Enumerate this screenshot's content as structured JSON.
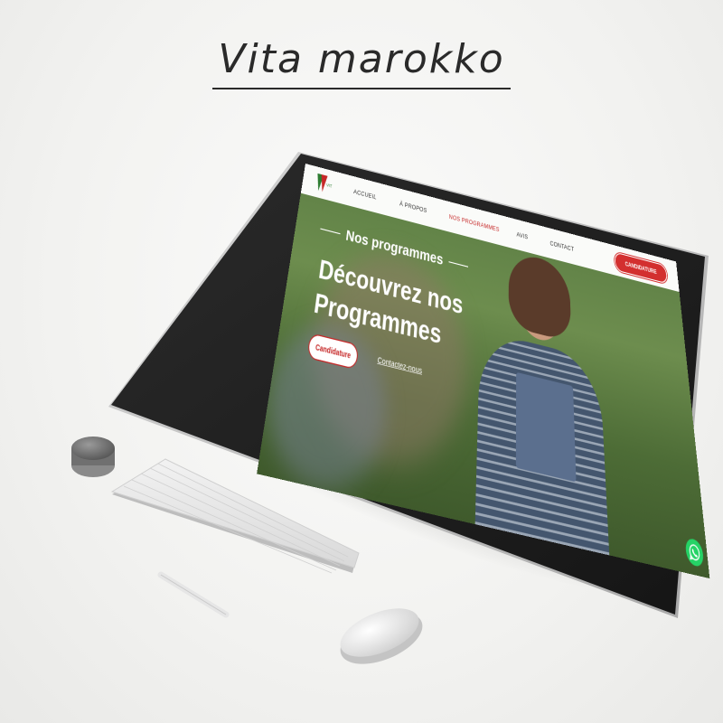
{
  "page": {
    "title": "Vita marokko"
  },
  "site": {
    "logo_icon": "vita-logo-icon",
    "nav": {
      "links": [
        "ACCUEIL",
        "À PROPOS",
        "NOS PROGRAMMES",
        "AVIS",
        "CONTACT"
      ],
      "active_index": 2,
      "cta_label": "CANDIDATURE"
    },
    "hero": {
      "kicker": "Nos programmes",
      "title_line1": "Découvrez nos",
      "title_line2": "Programmes",
      "button_label": "Candidature",
      "link_label": "Contactez-nous"
    },
    "whatsapp_icon": "whatsapp-icon"
  },
  "colors": {
    "accent": "#d32f2f",
    "background": "#f2f2f0",
    "nav_bg": "#ffffff",
    "hero_green": "#5d7f45"
  }
}
